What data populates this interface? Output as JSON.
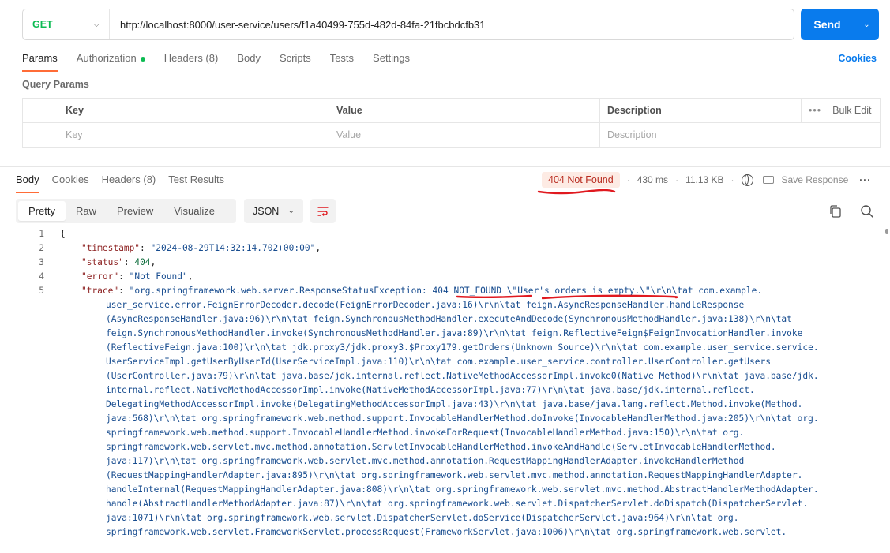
{
  "request": {
    "method": "GET",
    "url": "http://localhost:8000/user-service/users/f1a40499-755d-482d-84fa-21fbcbdcfb31",
    "send_label": "Send"
  },
  "request_tabs": [
    "Params",
    "Authorization",
    "Headers (8)",
    "Body",
    "Scripts",
    "Tests",
    "Settings"
  ],
  "cookies_link": "Cookies",
  "query_params": {
    "title": "Query Params",
    "headers": {
      "key": "Key",
      "value": "Value",
      "description": "Description",
      "bulk_edit": "Bulk Edit"
    },
    "placeholders": {
      "key": "Key",
      "value": "Value",
      "description": "Description"
    }
  },
  "response_tabs": [
    "Body",
    "Cookies",
    "Headers (8)",
    "Test Results"
  ],
  "response_meta": {
    "status": "404 Not Found",
    "time": "430 ms",
    "size": "11.13 KB",
    "save_response": "Save Response"
  },
  "view_modes": [
    "Pretty",
    "Raw",
    "Preview",
    "Visualize"
  ],
  "format": "JSON",
  "colors": {
    "accent": "#097bed",
    "tab_active": "#ff6c37",
    "status_error_bg": "#fdebe4",
    "status_error_text": "#b82b1f",
    "annotation": "#e0191f"
  },
  "body": {
    "line_numbers": [
      "1",
      "2",
      "3",
      "4",
      "5"
    ],
    "open_brace": "{",
    "timestamp_key": "\"timestamp\"",
    "timestamp_val": "\"2024-08-29T14:32:14.702+00:00\"",
    "status_key": "\"status\"",
    "status_val": "404",
    "error_key": "\"error\"",
    "error_val": "\"Not Found\"",
    "trace_key": "\"trace\"",
    "trace_first": "\"org.springframework.web.server.ResponseStatusException: 404 NOT_FOUND \\\"User's orders is empty.\\\"\\r\\n\\tat com.example.",
    "trace_lines": [
      "user_service.error.FeignErrorDecoder.decode(FeignErrorDecoder.java:16)\\r\\n\\tat feign.AsyncResponseHandler.handleResponse",
      "(AsyncResponseHandler.java:96)\\r\\n\\tat feign.SynchronousMethodHandler.executeAndDecode(SynchronousMethodHandler.java:138)\\r\\n\\tat",
      "feign.SynchronousMethodHandler.invoke(SynchronousMethodHandler.java:89)\\r\\n\\tat feign.ReflectiveFeign$FeignInvocationHandler.invoke",
      "(ReflectiveFeign.java:100)\\r\\n\\tat jdk.proxy3/jdk.proxy3.$Proxy179.getOrders(Unknown Source)\\r\\n\\tat com.example.user_service.service.",
      "UserServiceImpl.getUserByUserId(UserServiceImpl.java:110)\\r\\n\\tat com.example.user_service.controller.UserController.getUsers",
      "(UserController.java:79)\\r\\n\\tat java.base/jdk.internal.reflect.NativeMethodAccessorImpl.invoke0(Native Method)\\r\\n\\tat java.base/jdk.",
      "internal.reflect.NativeMethodAccessorImpl.invoke(NativeMethodAccessorImpl.java:77)\\r\\n\\tat java.base/jdk.internal.reflect.",
      "DelegatingMethodAccessorImpl.invoke(DelegatingMethodAccessorImpl.java:43)\\r\\n\\tat java.base/java.lang.reflect.Method.invoke(Method.",
      "java:568)\\r\\n\\tat org.springframework.web.method.support.InvocableHandlerMethod.doInvoke(InvocableHandlerMethod.java:205)\\r\\n\\tat org.",
      "springframework.web.method.support.InvocableHandlerMethod.invokeForRequest(InvocableHandlerMethod.java:150)\\r\\n\\tat org.",
      "springframework.web.servlet.mvc.method.annotation.ServletInvocableHandlerMethod.invokeAndHandle(ServletInvocableHandlerMethod.",
      "java:117)\\r\\n\\tat org.springframework.web.servlet.mvc.method.annotation.RequestMappingHandlerAdapter.invokeHandlerMethod",
      "(RequestMappingHandlerAdapter.java:895)\\r\\n\\tat org.springframework.web.servlet.mvc.method.annotation.RequestMappingHandlerAdapter.",
      "handleInternal(RequestMappingHandlerAdapter.java:808)\\r\\n\\tat org.springframework.web.servlet.mvc.method.AbstractHandlerMethodAdapter.",
      "handle(AbstractHandlerMethodAdapter.java:87)\\r\\n\\tat org.springframework.web.servlet.DispatcherServlet.doDispatch(DispatcherServlet.",
      "java:1071)\\r\\n\\tat org.springframework.web.servlet.DispatcherServlet.doService(DispatcherServlet.java:964)\\r\\n\\tat org.",
      "springframework.web.servlet.FrameworkServlet.processRequest(FrameworkServlet.java:1006)\\r\\n\\tat org.springframework.web.servlet."
    ]
  }
}
